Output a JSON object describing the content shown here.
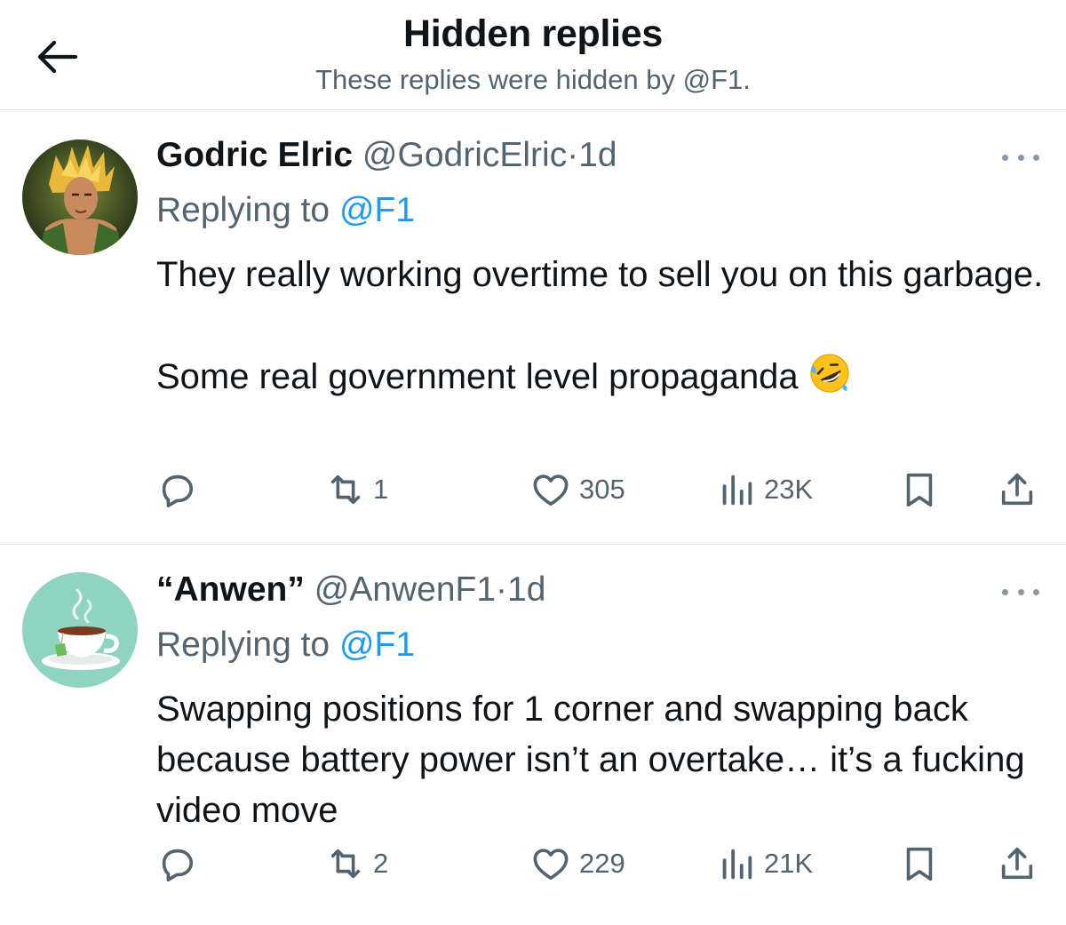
{
  "header": {
    "title": "Hidden replies",
    "subtitle": "These replies were hidden by @F1."
  },
  "tweets": [
    {
      "display_name": "Godric Elric",
      "handle": "@GodricElric",
      "separator": "·",
      "time": "1d",
      "replying_prefix": "Replying to",
      "replying_to": "@F1",
      "text_lines": [
        "They really working overtime to sell you on this garbage.",
        "Some real government level propaganda"
      ],
      "emoji": "rolling-on-floor-laughing",
      "replies": "",
      "retweets": "1",
      "likes": "305",
      "views": "23K"
    },
    {
      "display_name": "“Anwen”",
      "handle": "@AnwenF1",
      "separator": "·",
      "time": "1d",
      "replying_prefix": "Replying to",
      "replying_to": "@F1",
      "text_lines": [
        "Swapping positions for 1 corner and swapping back because battery power isn’t an overtake… it’s a fucking video move"
      ],
      "replies": "",
      "retweets": "2",
      "likes": "229",
      "views": "21K"
    }
  ],
  "colors": {
    "text": "#0f1419",
    "secondary": "#536471",
    "link": "#1d9bf0",
    "divider": "#e6e9ec"
  },
  "icons": [
    "back-arrow-icon",
    "more-icon",
    "reply-icon",
    "retweet-icon",
    "like-icon",
    "views-icon",
    "bookmark-icon",
    "share-icon"
  ]
}
